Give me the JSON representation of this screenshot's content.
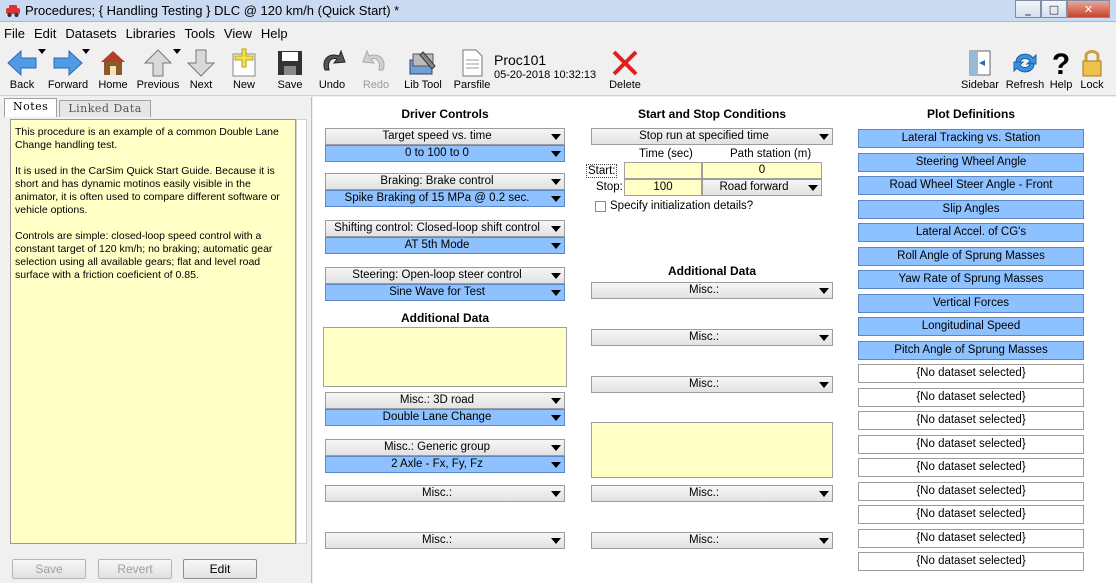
{
  "window": {
    "title": "Procedures;  { Handling Testing }  DLC @ 120 km/h (Quick Start) *",
    "controls": [
      "minimize",
      "maximize",
      "close"
    ]
  },
  "menu": [
    "File",
    "Edit",
    "Datasets",
    "Libraries",
    "Tools",
    "View",
    "Help"
  ],
  "toolbar": {
    "back": "Back",
    "forward": "Forward",
    "home": "Home",
    "previous": "Previous",
    "next": "Next",
    "new": "New",
    "save": "Save",
    "undo": "Undo",
    "redo": "Redo",
    "libtool": "Lib Tool",
    "parsfile": "Parsfile",
    "delete": "Delete",
    "sidebar": "Sidebar",
    "refresh": "Refresh",
    "help": "Help",
    "lock": "Lock"
  },
  "dataset": {
    "name": "Proc101",
    "date": "05-20-2018 10:32:13"
  },
  "left": {
    "tabs": [
      "Notes",
      "Linked Data"
    ],
    "notes": "This procedure is an example of a common Double Lane Change handling test.\n\nIt is used in the CarSim Quick Start Guide. Because it is short and has dynamic motinos easily visible in the animator, it is often used to compare different software or vehicle options.\n\nControls are simple: closed-loop speed control with a constant target of 120 km/h; no braking; automatic gear selection using all available gears; flat and level road surface with a friction coeficient of 0.85.",
    "buttons": [
      "Save",
      "Revert",
      "Edit"
    ]
  },
  "driver": {
    "heading": "Driver Controls",
    "rows": [
      {
        "cat": "Target speed vs. time",
        "val": "0 to 100 to 0"
      },
      {
        "cat": "Braking: Brake control",
        "val": "Spike Braking of 15 MPa @ 0.2 sec."
      },
      {
        "cat": "Shifting control: Closed-loop shift control",
        "val": "AT 5th Mode"
      },
      {
        "cat": "Steering: Open-loop steer control",
        "val": "Sine Wave for Test"
      }
    ],
    "additional_heading": "Additional Data",
    "misc": [
      {
        "cat": "Misc.: 3D road",
        "val": "Double Lane Change"
      },
      {
        "cat": "Misc.: Generic group",
        "val": "2 Axle - Fx, Fy, Fz"
      },
      {
        "cat": "Misc.:"
      },
      {
        "cat": "Misc.:"
      }
    ]
  },
  "startstop": {
    "heading": "Start and Stop Conditions",
    "mode": "Stop run at specified time",
    "col_time": "Time (sec)",
    "col_station": "Path station (m)",
    "start_label": "Start:",
    "stop_label": "Stop:",
    "start_time": "",
    "start_station": "0",
    "stop_time": "100",
    "stop_station": "Road forward",
    "init_label": "Specify initialization details?",
    "additional_heading": "Additional Data",
    "misc": [
      "Misc.:",
      "Misc.:",
      "Misc.:",
      "Misc.:",
      "Misc.:"
    ]
  },
  "plots": {
    "heading": "Plot Definitions",
    "items": [
      "Lateral Tracking vs. Station",
      "Steering Wheel Angle",
      "Road Wheel Steer Angle - Front",
      "Slip Angles",
      "Lateral Accel. of CG's",
      "Roll Angle of Sprung Masses",
      "Yaw Rate of Sprung Masses",
      "Vertical Forces",
      "Longitudinal Speed",
      "Pitch Angle of Sprung Masses",
      "{No dataset selected}",
      "{No dataset selected}",
      "{No dataset selected}",
      "{No dataset selected}",
      "{No dataset selected}",
      "{No dataset selected}",
      "{No dataset selected}",
      "{No dataset selected}",
      "{No dataset selected}"
    ]
  }
}
